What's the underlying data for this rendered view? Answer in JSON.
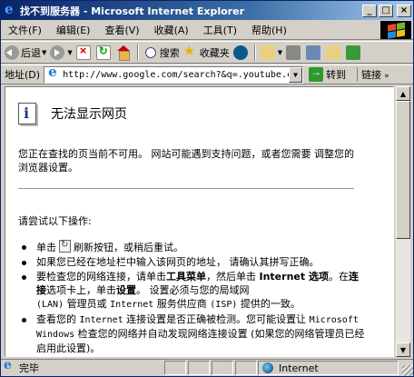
{
  "window": {
    "title": "找不到服务器 - Microsoft Internet Explorer",
    "controls": [
      "_",
      "□",
      "×"
    ]
  },
  "menubar": {
    "items": [
      "文件(F)",
      "编辑(E)",
      "查看(V)",
      "收藏(A)",
      "工具(T)",
      "帮助(H)"
    ]
  },
  "toolbar": {
    "back_label": "后退",
    "search_label": "搜索",
    "favorites_label": "收藏夹"
  },
  "addressbar": {
    "label": "地址(D)",
    "url": "http://www.google.com/search?&q=.youtube.com",
    "go_label": "转到",
    "links_label": "链接"
  },
  "page": {
    "title": "无法显示网页",
    "para1": "您正在查找的页当前不可用。 网站可能遇到支持问题，或者您需要 调整您的浏览器设置。",
    "para2": "请尝试以下操作:",
    "list": {
      "item1_a": "单击",
      "item1_b": "刷新按钮，或稍后重试。",
      "item2": "如果您已经在地址栏中输入该网页的地址， 请确认其拼写正确。",
      "item3_a": "要检查您的网络连接，请单击",
      "item3_b": "工具菜单",
      "item3_c": "，然后单击 ",
      "item3_d": "Internet 选项",
      "item3_e": "。在",
      "item3_f": "连接",
      "item3_g": "选项卡上，单击",
      "item3_h": "设置",
      "item3_i": "。 设置必须与您的局域网",
      "item3_j": "(LAN)",
      "item3_k": " 管理员或 ",
      "item3_l": "Internet",
      "item3_m": " 服务供应商 ",
      "item3_n": "(ISP)",
      "item3_o": " 提供的一致。",
      "item4_a": "查看您的 ",
      "item4_b": "Internet",
      "item4_c": " 连接设置是否正确被检测。您可能设置让 ",
      "item4_d": "Microsoft Windows",
      "item4_e": " 检查您的网络并自动发现网络连接设置 (如果您的网络管理员已经启用此设置)。"
    }
  },
  "statusbar": {
    "text": "完毕",
    "zone": "Internet"
  },
  "colors": {
    "titlebar": "#0a246a",
    "chrome": "#d4d0c8"
  }
}
